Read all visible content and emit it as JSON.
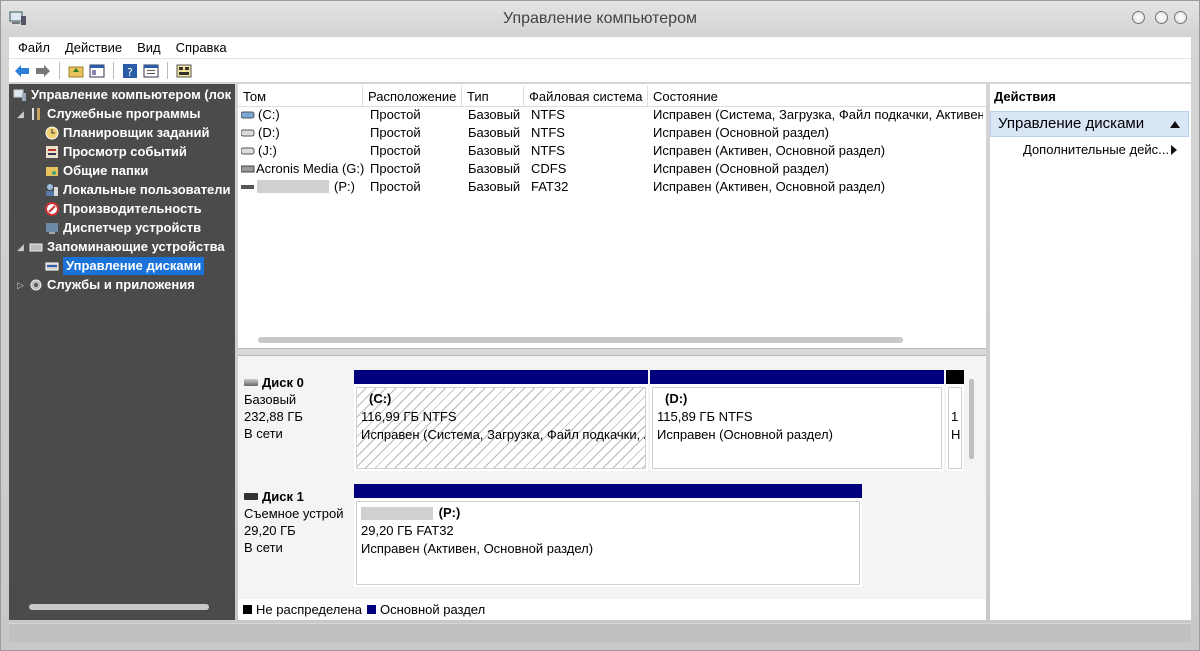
{
  "window": {
    "title": "Управление компьютером"
  },
  "menu": [
    "Файл",
    "Действие",
    "Вид",
    "Справка"
  ],
  "tree": {
    "root": "Управление компьютером (лок",
    "items": [
      {
        "label": "Служебные программы",
        "icon": "tools-icon"
      },
      {
        "label": "Планировщик заданий",
        "icon": "clock-icon"
      },
      {
        "label": "Просмотр событий",
        "icon": "event-viewer-icon"
      },
      {
        "label": "Общие папки",
        "icon": "shared-folder-icon"
      },
      {
        "label": "Локальные пользователи",
        "icon": "users-icon"
      },
      {
        "label": "Производительность",
        "icon": "performance-icon"
      },
      {
        "label": "Диспетчер устройств",
        "icon": "device-manager-icon"
      },
      {
        "label": "Запоминающие устройства",
        "icon": "storage-icon"
      },
      {
        "label": "Управление дисками",
        "icon": "disk-management-icon"
      },
      {
        "label": "Службы и приложения",
        "icon": "services-icon"
      }
    ]
  },
  "volumes": {
    "columns": [
      "Том",
      "Расположение",
      "Тип",
      "Файловая система",
      "Состояние"
    ],
    "rows": [
      [
        "(C:)",
        "Простой",
        "Базовый",
        "NTFS",
        "Исправен (Система, Загрузка, Файл подкачки, Активен,"
      ],
      [
        "(D:)",
        "Простой",
        "Базовый",
        "NTFS",
        "Исправен (Основной раздел)"
      ],
      [
        "(J:)",
        "Простой",
        "Базовый",
        "NTFS",
        "Исправен (Активен, Основной раздел)"
      ],
      [
        "Acronis Media (G:)",
        "Простой",
        "Базовый",
        "CDFS",
        "Исправен (Основной раздел)"
      ],
      [
        "(P:)",
        "Простой",
        "Базовый",
        "FAT32",
        "Исправен (Активен, Основной раздел)"
      ]
    ]
  },
  "disks": [
    {
      "name": "Диск 0",
      "type": "Базовый",
      "size": "232,88 ГБ",
      "status": "В сети",
      "partitions": [
        {
          "name": "(C:)",
          "size": "116,99 ГБ NTFS",
          "state": "Исправен (Система, Загрузка, Файл подкачки, А"
        },
        {
          "name": "(D:)",
          "size": "115,89 ГБ NTFS",
          "state": "Исправен (Основной раздел)"
        },
        {
          "name": "",
          "size": "1",
          "state": "Н"
        }
      ]
    },
    {
      "name": "Диск 1",
      "type": "Съемное устрой",
      "size": "29,20 ГБ",
      "status": "В сети",
      "partitions": [
        {
          "name": "(P:)",
          "size": "29,20 ГБ FAT32",
          "state": "Исправен (Активен, Основной раздел)"
        }
      ]
    }
  ],
  "legend": [
    {
      "label": "Не распределена",
      "color": "#000000"
    },
    {
      "label": "Основной раздел",
      "color": "#00007f"
    }
  ],
  "actions": {
    "header": "Действия",
    "selected": "Управление дисками",
    "more": "Дополнительные дейс..."
  },
  "colors": {
    "selection": "#1a73d9",
    "primary_partition": "#00007f",
    "tree_bg": "#4b4b4b"
  }
}
